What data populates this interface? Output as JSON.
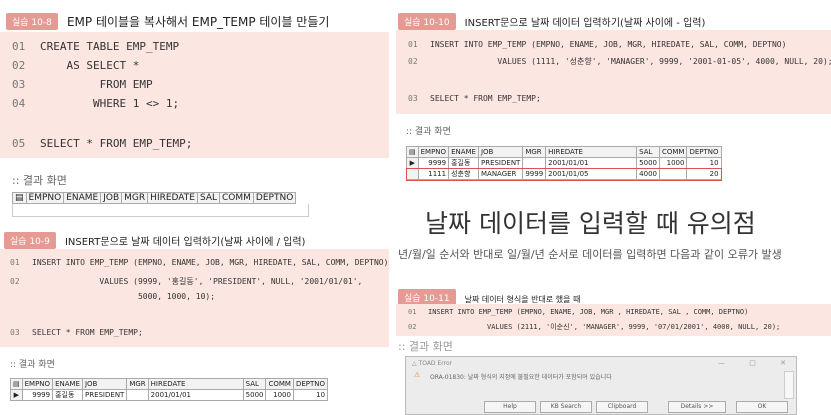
{
  "ex8": {
    "badge": "실습 10-8",
    "title": "EMP 테이블을 복사해서 EMP_TEMP 테이블 만들기",
    "lines": [
      {
        "n": "01",
        "code": "CREATE TABLE EMP_TEMP"
      },
      {
        "n": "02",
        "code": "    AS SELECT *"
      },
      {
        "n": "03",
        "code": "         FROM EMP"
      },
      {
        "n": "04",
        "code": "        WHERE 1 <> 1;"
      },
      {
        "n": "05",
        "code": "SELECT * FROM EMP_TEMP;"
      }
    ],
    "result_label": ":: 결과 화면",
    "columns": [
      "EMPNO",
      "ENAME",
      "JOB",
      "MGR",
      "HIREDATE",
      "SAL",
      "COMM",
      "DEPTNO"
    ]
  },
  "ex9": {
    "badge": "실습 10-9",
    "title": "INSERT문으로 날짜 데이터 입력하기(날짜 사이에 / 입력)",
    "lines": [
      {
        "n": "01",
        "code": "INSERT INTO EMP_TEMP (EMPNO, ENAME, JOB, MGR, HIREDATE, SAL, COMM, DEPTNO)"
      },
      {
        "n": "02",
        "code": "              VALUES (9999, '홍길동', 'PRESIDENT', NULL, '2001/01/01',"
      },
      {
        "n": "",
        "code": "                      5000, 1000, 10);"
      },
      {
        "n": "03",
        "code": "SELECT * FROM EMP_TEMP;"
      }
    ],
    "result_label": ":: 결과 화면",
    "columns": [
      "EMPNO",
      "ENAME",
      "JOB",
      "MGR",
      "HIREDATE",
      "SAL",
      "COMM",
      "DEPTNO"
    ],
    "rows": [
      {
        "marker": "▶",
        "cells": [
          "9999",
          "홍길동",
          "PRESIDENT",
          "",
          "2001/01/01",
          "5000",
          "1000",
          "10"
        ]
      }
    ]
  },
  "ex10": {
    "badge": "실습 10-10",
    "title": "INSERT문으로 날짜 데이터 입력하기(날짜 사이에 - 입력)",
    "lines": [
      {
        "n": "01",
        "code": "INSERT INTO EMP_TEMP (EMPNO, ENAME, JOB, MGR, HIREDATE, SAL, COMM, DEPTNO)"
      },
      {
        "n": "02",
        "code": "              VALUES (1111, '성춘향', 'MANAGER', 9999, '2001-01-05', 4000, NULL, 20);"
      },
      {
        "n": "03",
        "code": "SELECT * FROM EMP_TEMP;"
      }
    ],
    "result_label": ":: 결과 화면",
    "columns": [
      "EMPNO",
      "ENAME",
      "JOB",
      "MGR",
      "HIREDATE",
      "SAL",
      "COMM",
      "DEPTNO"
    ],
    "rows": [
      {
        "marker": "▶",
        "cells": [
          "9999",
          "홍길동",
          "PRESIDENT",
          "",
          "2001/01/01",
          "5000",
          "1000",
          "10"
        ]
      },
      {
        "marker": "",
        "cells": [
          "1111",
          "성춘향",
          "MANAGER",
          "9999",
          "2001/01/05",
          "4000",
          "",
          "20"
        ]
      }
    ]
  },
  "section": {
    "heading": "날짜 데이터를 입력할 때 유의점",
    "text": "년/월/일 순서와 반대로 일/월/년 순서로 데이터를 입력하면 다음과 같이 오류가 발생"
  },
  "ex11": {
    "badge": "실습 10-11",
    "title": "날짜 데이터 형식을 반대로 했을 때",
    "lines": [
      {
        "n": "01",
        "code": "INSERT INTO EMP_TEMP (EMPNO, ENAME, JOB, MGR , HIREDATE, SAL , COMM, DEPTNO)"
      },
      {
        "n": "02",
        "code": "              VALUES (2111, '이순신', 'MANAGER', 9999, '07/01/2001', 4000, NULL, 20);"
      }
    ],
    "result_label": ":: 결과 화면",
    "dialog": {
      "title": "TOAD Error",
      "message": "ORA-01830: 날짜 형식의 지정에 불필요한 데이터가 포함되어 있습니다",
      "buttons": [
        "Help",
        "KB Search",
        "Clipboard",
        "Details >>",
        "OK"
      ],
      "win_controls": [
        "—",
        "□",
        "✕"
      ]
    }
  },
  "colors": {
    "badge": "#e59a93",
    "code_bg": "#fbe6e2",
    "highlight_row": "#d9534f"
  }
}
